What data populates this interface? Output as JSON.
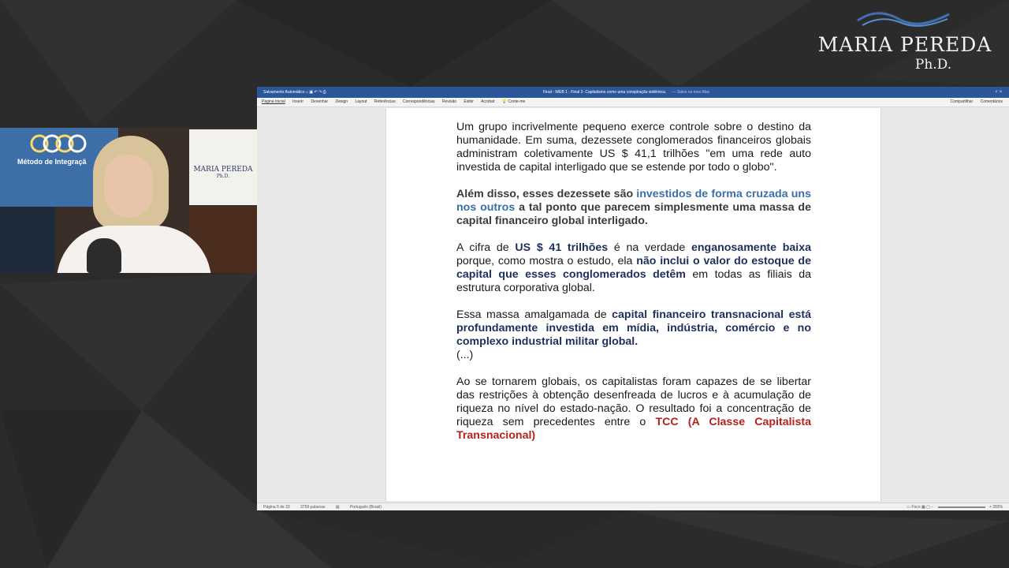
{
  "logo": {
    "name": "Maria Pereda",
    "suffix": "Ph.D."
  },
  "webcam": {
    "banner_text": "Método de Integraçã",
    "poster_name": "MARIA PEREDA",
    "poster_suffix": "Ph.D."
  },
  "word": {
    "titlebar": {
      "autosave": "Salvamento Automático",
      "doc_title": "Final - WEB 1 - Final 2- Capitalismo como uma conspiração sistêmica.",
      "save_status": "— Salvo no meu Mac"
    },
    "ribbon": {
      "tabs": [
        "Página Inicial",
        "Inserir",
        "Desenhar",
        "Design",
        "Layout",
        "Referências",
        "Correspondências",
        "Revisão",
        "Exibir",
        "Acrobat"
      ],
      "tell_me": "Conte-me",
      "share": "Compartilhar",
      "comments": "Comentários"
    },
    "document": {
      "p1": "Um grupo incrivelmente pequeno exerce controle sobre o destino da humanidade. Em suma, dezessete conglomerados financeiros globais administram coletivamente US $ 41,1 trilhões \"em uma rede auto investida de capital interligado que se estende por todo o globo\".",
      "p2": {
        "a": " Além disso, esses dezessete são ",
        "b": "investidos de forma cruzada uns nos outros",
        "c": " a tal ponto que parecem simplesmente uma massa de capital financeiro global interligado."
      },
      "p3": {
        "a": "A cifra de ",
        "b": "US $ 41 trilhões",
        "c": " é na verdade ",
        "d": "enganosamente baixa",
        "e": " porque, como mostra o estudo, ela ",
        "f": "não inclui o valor do estoque de capital que esses conglomerados detêm",
        "g": " em todas as filiais da estrutura corporativa global."
      },
      "p4": {
        "a": "Essa massa amalgamada de ",
        "b": "capital financeiro transnacional está profundamente investida em mídia, indústria, comércio e no complexo industrial militar global."
      },
      "ellipsis": "(...)",
      "p5": {
        "a": "Ao se tornarem globais, os capitalistas foram capazes de se libertar das restrições à obtenção desenfreada de lucros e à acumulação de riqueza no nível do estado-nação. O resultado foi a concentração de riqueza sem precedentes entre o ",
        "b": "TCC (A Classe Capitalista Transnacional)"
      }
    },
    "statusbar": {
      "page": "Página 5 de 33",
      "words": "3759 palavras",
      "language": "Português (Brasil)",
      "focus": "Foco",
      "zoom": "283%"
    }
  }
}
